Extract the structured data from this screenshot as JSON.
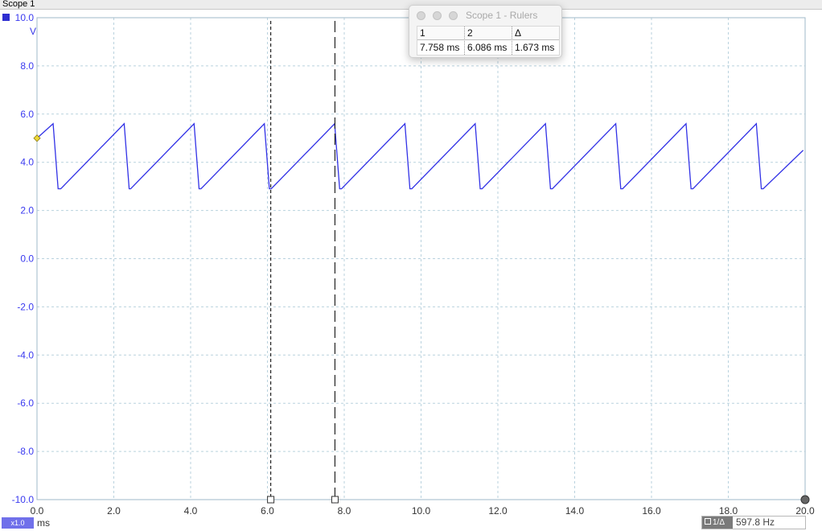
{
  "window": {
    "title": "Scope 1"
  },
  "y_axis": {
    "unit": "V",
    "ticks": [
      "10.0",
      "8.0",
      "6.0",
      "4.0",
      "2.0",
      "0.0",
      "-2.0",
      "-4.0",
      "-6.0",
      "-8.0",
      "-10.0"
    ]
  },
  "x_axis": {
    "unit": "ms",
    "ticks": [
      "0.0",
      "2.0",
      "4.0",
      "6.0",
      "8.0",
      "10.0",
      "12.0",
      "14.0",
      "16.0",
      "18.0",
      "20.0"
    ]
  },
  "zoom_badge": "x1.0",
  "frequency": {
    "label": "1/Δ",
    "value": "597.8 Hz"
  },
  "rulers_window": {
    "title": "Scope 1 - Rulers",
    "headers": [
      "1",
      "2",
      "Δ"
    ],
    "values": [
      "7.758 ms",
      "6.086 ms",
      "1.673 ms"
    ]
  },
  "colors": {
    "trace": "#3232e6",
    "axis_text": "#3a3af0",
    "grid": "#b9d2de",
    "trigger_marker": "#ecd738"
  },
  "chart_data": {
    "type": "line",
    "xlim": [
      0,
      20
    ],
    "ylim": [
      -10,
      10
    ],
    "grid": true,
    "rulers_ms": [
      6.086,
      7.758
    ],
    "trigger_level_v": 5.0,
    "series": [
      {
        "x": [
          0.0,
          0.42,
          0.55,
          0.62,
          2.27,
          2.4,
          2.44,
          4.09,
          4.22,
          4.27,
          5.92,
          6.05,
          6.1,
          7.75,
          7.88,
          7.93,
          9.58,
          9.71,
          9.76,
          11.41,
          11.54,
          11.59,
          13.24,
          13.37,
          13.42,
          15.07,
          15.2,
          15.25,
          16.9,
          17.03,
          17.08,
          18.73,
          18.86,
          18.91,
          19.95
        ],
        "y": [
          5.0,
          5.6,
          2.9,
          2.9,
          5.6,
          2.9,
          2.9,
          5.6,
          2.9,
          2.9,
          5.6,
          2.9,
          2.9,
          5.6,
          2.9,
          2.9,
          5.6,
          2.9,
          2.9,
          5.6,
          2.9,
          2.9,
          5.6,
          2.9,
          2.9,
          5.6,
          2.9,
          2.9,
          5.6,
          2.9,
          2.9,
          5.6,
          2.9,
          2.9,
          4.5
        ]
      }
    ]
  }
}
